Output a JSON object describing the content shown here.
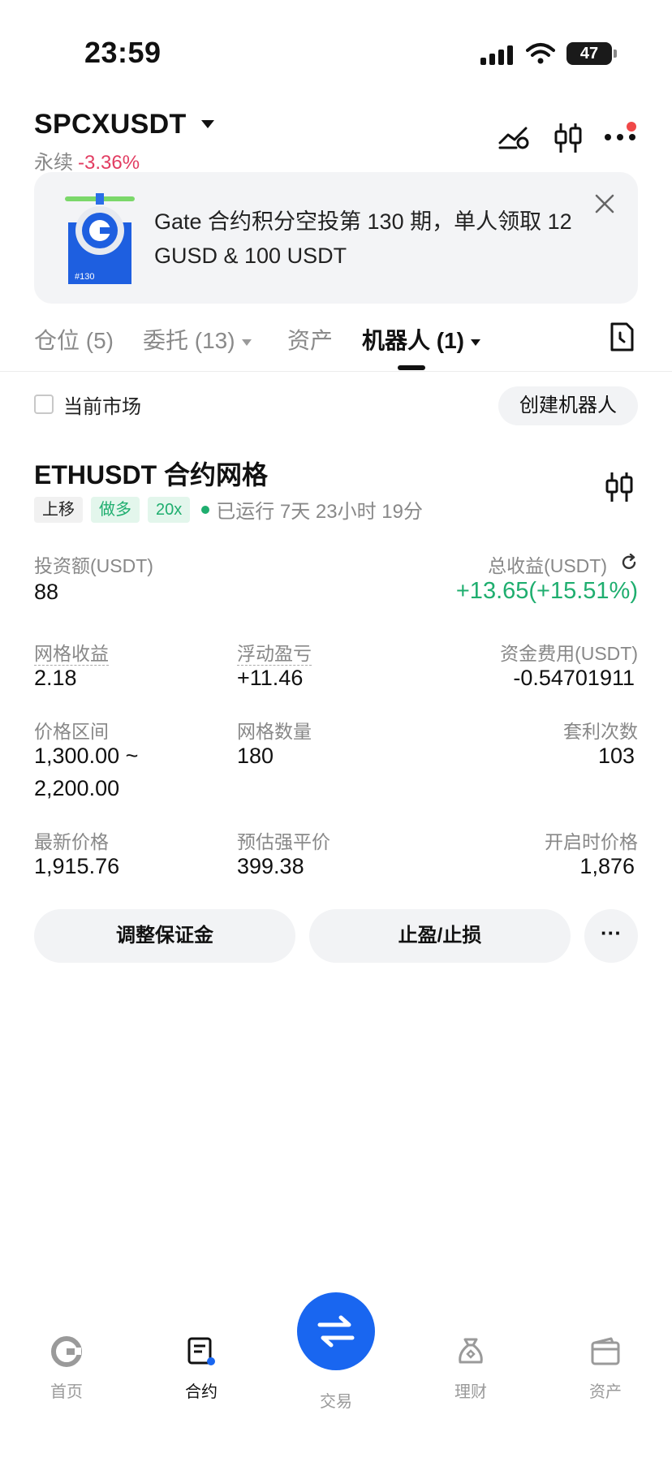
{
  "status_bar": {
    "time": "23:59",
    "battery": "47"
  },
  "header": {
    "pair": "SPCXUSDT",
    "type": "永续",
    "change": "-3.36%",
    "change_color": "#e23d62"
  },
  "banner": {
    "badge": "#130",
    "text": "Gate 合约积分空投第 130 期，单人领取 12 GUSD & 100 USDT"
  },
  "tabs": [
    {
      "label": "仓位 (5)"
    },
    {
      "label": "委托 (13)"
    },
    {
      "label": "资产"
    },
    {
      "label": "机器人 (1)"
    }
  ],
  "filter": {
    "label": "当前市场",
    "create_button": "创建机器人"
  },
  "bot": {
    "title": "ETHUSDT 合约网格",
    "tags": [
      "上移",
      "做多",
      "20x"
    ],
    "running": "已运行 7天 23小时 19分",
    "investment_label": "投资额(USDT)",
    "investment_value": "88",
    "total_profit_label": "总收益(USDT)",
    "total_profit_value": "+13.65(+15.51%)",
    "grid_profit_label": "网格收益",
    "grid_profit_value": "2.18",
    "floating_pnl_label": "浮动盈亏",
    "floating_pnl_value": "+11.46",
    "funding_fee_label": "资金费用(USDT)",
    "funding_fee_value": "-0.54701911",
    "price_range_label": "价格区间",
    "price_range_line1": "1,300.00 ~",
    "price_range_line2": "2,200.00",
    "grid_count_label": "网格数量",
    "grid_count_value": "180",
    "arbitrage_label": "套利次数",
    "arbitrage_value": "103",
    "last_price_label": "最新价格",
    "last_price_value": "1,915.76",
    "liq_price_label": "预估强平价",
    "liq_price_value": "399.38",
    "open_price_label": "开启时价格",
    "open_price_value": "1,876",
    "adjust_margin_button": "调整保证金",
    "tp_sl_button": "止盈/止损",
    "more_button": "···"
  },
  "nav": {
    "home": "首页",
    "futures": "合约",
    "trade": "交易",
    "finance": "理财",
    "assets": "资产"
  },
  "colors": {
    "accent": "#1966f0",
    "profit": "#1fae6f",
    "loss": "#e23d62"
  }
}
